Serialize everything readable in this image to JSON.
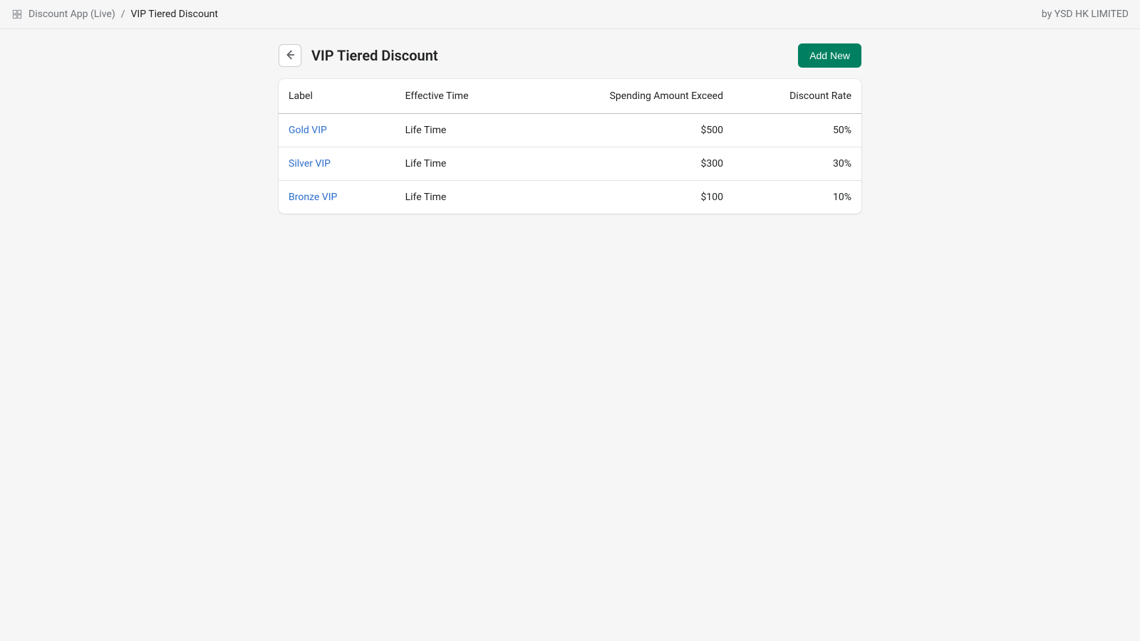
{
  "topbar": {
    "breadcrumb_parent": "Discount App (Live)",
    "breadcrumb_sep": "/",
    "breadcrumb_current": "VIP Tiered Discount",
    "attribution": "by YSD HK LIMITED"
  },
  "page": {
    "title": "VIP Tiered Discount",
    "add_button": "Add New"
  },
  "table": {
    "headers": {
      "label": "Label",
      "effective_time": "Effective Time",
      "spending_amount": "Spending Amount Exceed",
      "discount_rate": "Discount Rate"
    },
    "rows": [
      {
        "label": "Gold VIP",
        "effective_time": "Life Time",
        "spending_amount": "$500",
        "discount_rate": "50%"
      },
      {
        "label": "Silver VIP",
        "effective_time": "Life Time",
        "spending_amount": "$300",
        "discount_rate": "30%"
      },
      {
        "label": "Bronze VIP",
        "effective_time": "Life Time",
        "spending_amount": "$100",
        "discount_rate": "10%"
      }
    ]
  }
}
